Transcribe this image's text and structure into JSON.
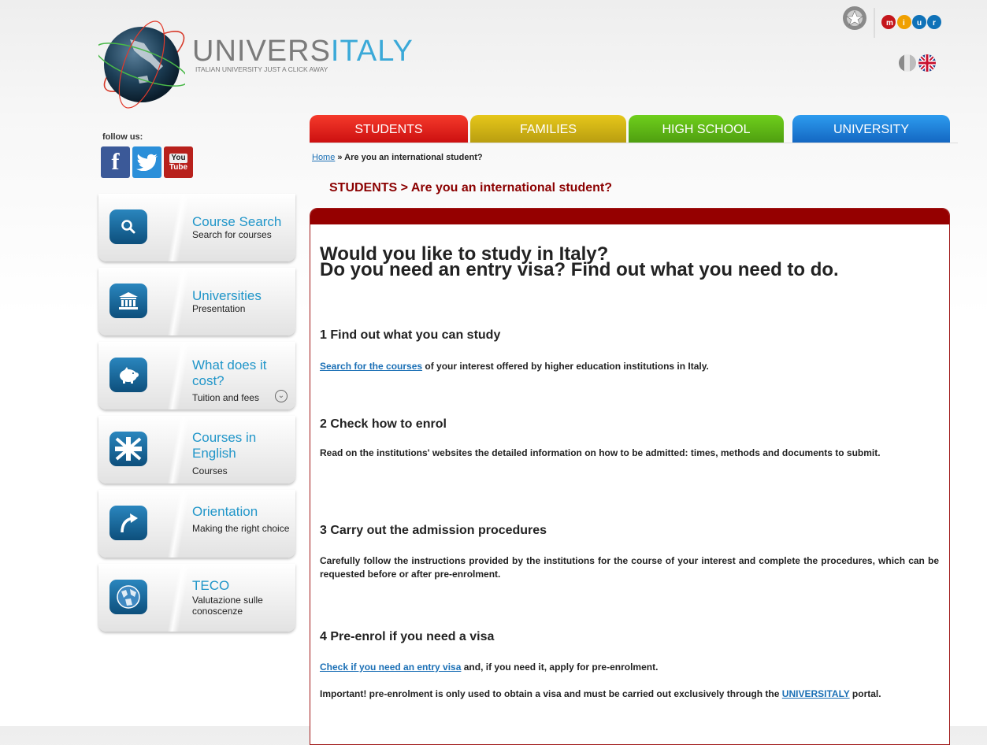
{
  "brand": {
    "name_part1": "UNIVERS",
    "name_part2": "ITALY",
    "tagline": "ITALIAN UNIVERSITY JUST A CLICK AWAY",
    "colors": {
      "grey": "#7b7b7b",
      "blue": "#3ba9d8"
    }
  },
  "social": {
    "label": "follow us:",
    "facebook_glyph": "f",
    "youtube_top": "You",
    "youtube_bottom": "Tube",
    "icons": [
      "facebook-icon",
      "twitter-icon",
      "youtube-icon"
    ]
  },
  "menu": [
    {
      "title": "Course Search",
      "subtitle": "Search for courses",
      "icon": "search-icon"
    },
    {
      "title": "Universities",
      "subtitle": "Presentation",
      "icon": "building-icon"
    },
    {
      "title": "What does it cost?",
      "subtitle": "Tuition and fees",
      "icon": "piggy-bank-icon",
      "expand_icon": "chevron-down-icon"
    },
    {
      "title": "Courses in English",
      "subtitle": "Courses",
      "icon": "union-jack-icon"
    },
    {
      "title": "Orientation",
      "subtitle": "Making the right choice",
      "icon": "arrow-turn-icon"
    },
    {
      "title": "TECO",
      "subtitle": "Valutazione sulle conoscenze",
      "icon": "globe-icon"
    }
  ],
  "tabs": [
    {
      "label": "STUDENTS",
      "color": "#e22a1c"
    },
    {
      "label": "FAMILIES",
      "color": "#d4b515"
    },
    {
      "label": "HIGH SCHOOL",
      "color": "#5fb816"
    },
    {
      "label": "UNIVERSITY",
      "color": "#1f80d8"
    }
  ],
  "breadcrumb": {
    "home": "Home",
    "separator": " » ",
    "current": "Are you an international student?"
  },
  "section_title": "STUDENTS > Are you an international student?",
  "content": {
    "heading_line1": "Would you like to study in Italy?",
    "heading_line2": "Do you need an entry visa? Find out what you need to do.",
    "steps": [
      {
        "title": "1 Find out what you can study",
        "link": "Search for the courses",
        "text": " of your interest offered by higher education institutions in Italy."
      },
      {
        "title": "2 Check how to enrol",
        "text": "Read on the institutions' websites the detailed information on how to be admitted: times, methods and documents to submit."
      },
      {
        "title": "3 Carry out the admission procedures",
        "text": "Carefully follow the instructions provided by the institutions for the course of your interest and complete the procedures, which can be requested before or after pre-enrolment."
      },
      {
        "title": "4 Pre-enrol if you need a visa",
        "link": "Check if you need an entry visa",
        "text": " and, if you need it, apply for pre-enrolment.",
        "note_text": "Important! pre-enrolment is only used to obtain a visa and must be carried out exclusively through the ",
        "note_link": "UNIVERSITALY",
        "note_end": " portal."
      }
    ]
  },
  "language_flags": [
    "italy-flag-icon",
    "uk-flag-icon"
  ],
  "ministry_logos": [
    "italian-republic-emblem-icon",
    "miur-logo-icon"
  ]
}
